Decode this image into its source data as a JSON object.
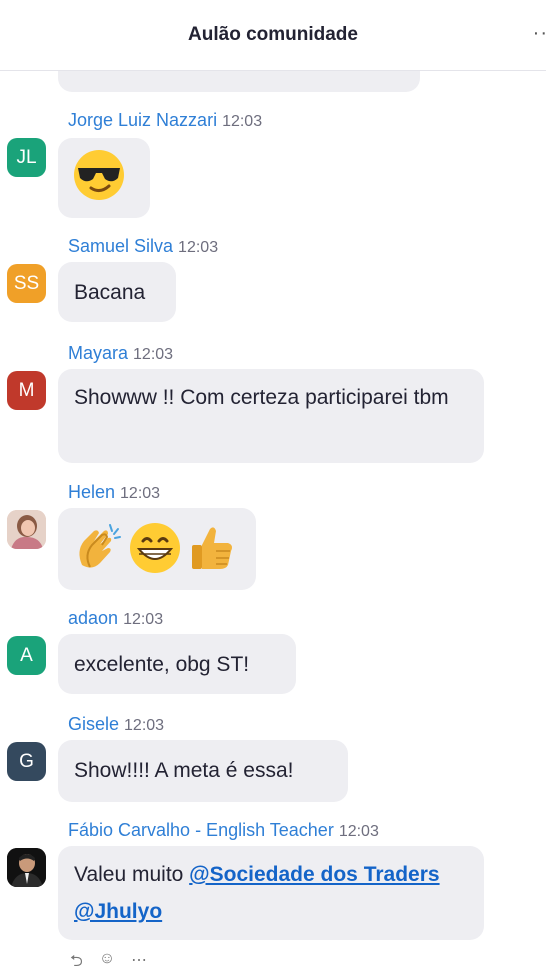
{
  "header": {
    "title": "Aulão comunidade",
    "more_label": "··"
  },
  "messages": [
    {
      "initials": "JL",
      "avatar_color": "#1aa37a",
      "name": "Jorge Luiz Nazzari",
      "time": "12:03",
      "kind": "emoji",
      "emojis": [
        "smiling-face-with-sunglasses"
      ]
    },
    {
      "initials": "SS",
      "avatar_color": "#f0a028",
      "name": "Samuel Silva",
      "time": "12:03",
      "kind": "text",
      "text": "Bacana"
    },
    {
      "initials": "M",
      "avatar_color": "#c0392b",
      "name": "Mayara",
      "time": "12:03",
      "kind": "text",
      "text": "Showww !! Com certeza participarei tbm"
    },
    {
      "initials": "",
      "avatar_color": "#d9a9a0",
      "name": "Helen",
      "time": "12:03",
      "kind": "emoji",
      "emojis": [
        "clapping-hands",
        "grinning-face",
        "thumbs-up"
      ]
    },
    {
      "initials": "A",
      "avatar_color": "#1aa37a",
      "name": "adaon",
      "time": "12:03",
      "kind": "text",
      "text": "excelente, obg ST!"
    },
    {
      "initials": "G",
      "avatar_color": "#34495e",
      "name": "Gisele",
      "time": "12:03",
      "kind": "text",
      "text": "Show!!!! A meta é essa!"
    },
    {
      "initials": "",
      "avatar_color": "#1c1c1c",
      "name": "Fábio Carvalho - English Teacher",
      "time": "12:03",
      "kind": "mention",
      "prefix": "Valeu muito ",
      "mention1": "@Sociedade dos Traders",
      "mention2": "@Jhulyo"
    }
  ]
}
